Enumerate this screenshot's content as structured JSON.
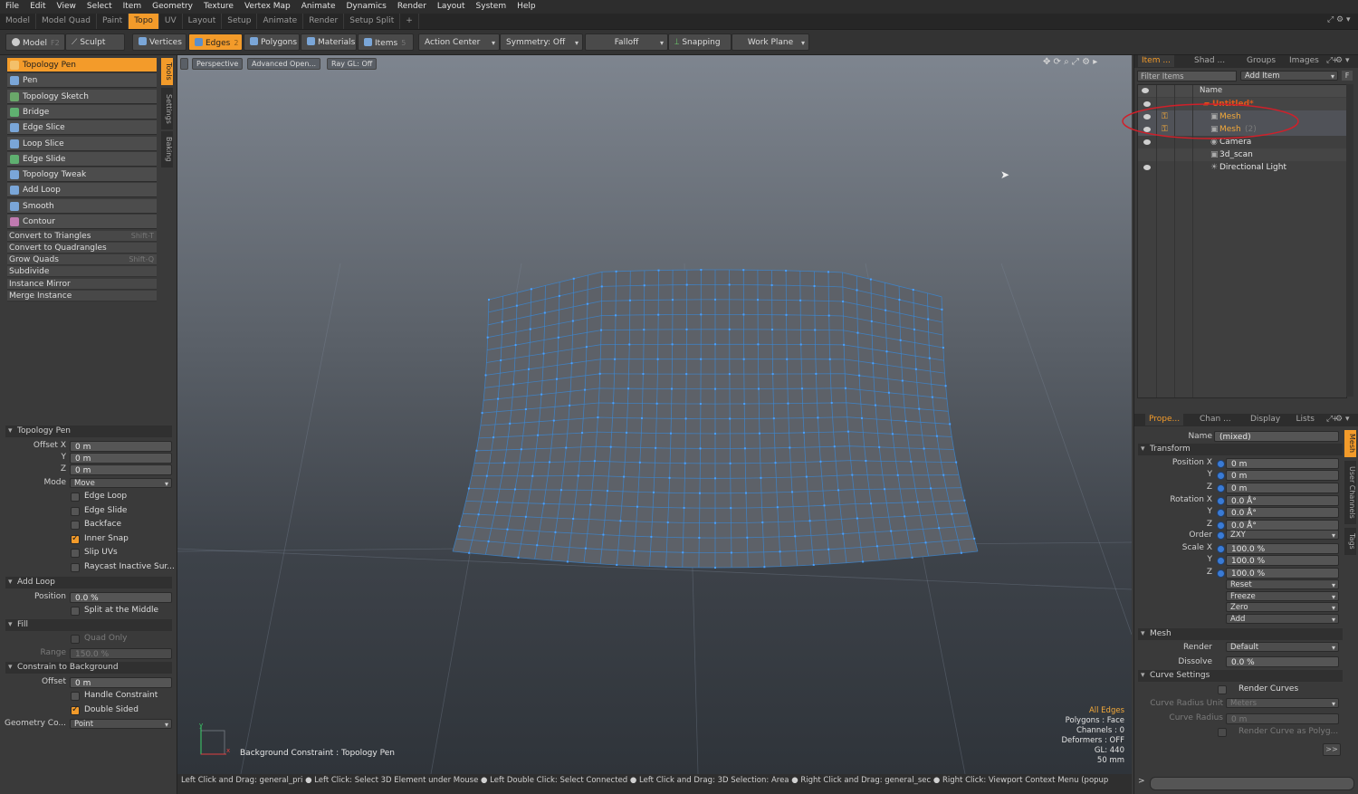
{
  "menu": [
    "File",
    "Edit",
    "View",
    "Select",
    "Item",
    "Geometry",
    "Texture",
    "Vertex Map",
    "Animate",
    "Dynamics",
    "Render",
    "Layout",
    "System",
    "Help"
  ],
  "layouts": [
    "Model",
    "Model Quad",
    "Paint",
    "Topo",
    "UV",
    "Layout",
    "Setup",
    "Animate",
    "Render",
    "Setup Split",
    "+"
  ],
  "layouts_active": "Topo",
  "toolbar": {
    "model": "Model",
    "model_key": "F2",
    "sculpt": "Sculpt",
    "vertices": "Vertices",
    "edges": "Edges",
    "edges_count": "2",
    "polygons": "Polygons",
    "materials": "Materials",
    "items": "Items",
    "items_count": "5",
    "action_center": "Action Center",
    "symmetry": "Symmetry: Off",
    "falloff": "Falloff",
    "snapping": "Snapping",
    "work_plane": "Work Plane"
  },
  "side_tabs": [
    "Tools",
    "Settings",
    "Baking"
  ],
  "tools": [
    "Topology Pen",
    "Pen",
    "Topology Sketch",
    "Bridge",
    "Edge Slice",
    "Loop Slice",
    "Edge Slide",
    "Topology Tweak",
    "Add Loop",
    "Smooth",
    "Contour"
  ],
  "tool_selected": "Topology Pen",
  "commands": [
    {
      "label": "Convert to Triangles",
      "shortcut": "Shift-T"
    },
    {
      "label": "Convert to Quadrangles",
      "shortcut": ""
    },
    {
      "label": "Grow Quads",
      "shortcut": "Shift-Q"
    },
    {
      "label": "Subdivide",
      "shortcut": ""
    }
  ],
  "commands2": [
    "Instance Mirror",
    "Merge Instance"
  ],
  "props": {
    "section_title": "Topology Pen",
    "offset_label": "Offset X",
    "y_label": "Y",
    "z_label": "Z",
    "offset_x": "0 m",
    "offset_y": "0 m",
    "offset_z": "0 m",
    "mode_label": "Mode",
    "mode": "Move",
    "checks": [
      {
        "label": "Edge Loop",
        "on": false
      },
      {
        "label": "Edge Slide",
        "on": false
      },
      {
        "label": "Backface",
        "on": false
      },
      {
        "label": "Inner Snap",
        "on": true
      },
      {
        "label": "Slip UVs",
        "on": false
      },
      {
        "label": "Raycast Inactive Sur...",
        "on": false
      }
    ],
    "add_loop_title": "Add Loop",
    "position_label": "Position",
    "position": "0.0 %",
    "split_middle": "Split at the Middle",
    "fill_title": "Fill",
    "quad_only": "Quad Only",
    "range_label": "Range",
    "range": "150.0 %",
    "constrain_title": "Constrain to Background",
    "offset2_label": "Offset",
    "offset2": "0 m",
    "handle_constraint": "Handle Constraint",
    "double_sided": "Double Sided",
    "geometry_label": "Geometry Co...",
    "geometry_value": "Point"
  },
  "viewport": {
    "perspective": "Perspective",
    "advanced": "Advanced Open...",
    "raygl": "Ray GL: Off",
    "constraint_label": "Background Constraint",
    "tool_label": "Topology Pen",
    "info_title": "All Edges",
    "info_lines": [
      "Polygons : Face",
      "Channels : 0",
      "Deformers : OFF",
      "GL: 440",
      "50 mm"
    ]
  },
  "status": "Left Click and Drag: general_pri ● Left Click: Select 3D Element under Mouse ● Left Double Click: Select Connected ● Left Click and Drag: 3D Selection: Area ● Right Click and Drag: general_sec ● Right Click: Viewport Context Menu (popup",
  "items_panel": {
    "tabs": [
      "Item ...",
      "Shad ...",
      "Groups",
      "Images",
      "+"
    ],
    "filter": "Filter Items",
    "add_item": "Add Item",
    "name_header": "Name",
    "rows": [
      {
        "label": "Untitled*",
        "kind": "scene",
        "selected": false
      },
      {
        "label": "Mesh",
        "kind": "mesh",
        "selected": true
      },
      {
        "label": "Mesh",
        "suffix": "(2)",
        "kind": "mesh",
        "selected": true
      },
      {
        "label": "Camera",
        "kind": "camera",
        "selected": false
      },
      {
        "label": "3d_scan",
        "kind": "scan",
        "selected": false
      },
      {
        "label": "Directional Light",
        "kind": "light",
        "selected": false
      }
    ]
  },
  "properties_panel": {
    "tabs": [
      "Prope...",
      "Chan ...",
      "Display",
      "Lists",
      "+"
    ],
    "side_tabs": [
      "Mesh",
      "User Channels",
      "Tags"
    ],
    "name_label": "Name",
    "name_value": "(mixed)",
    "transform_title": "Transform",
    "position_label": "Position X",
    "rotation_label": "Rotation X",
    "scale_label": "Scale X",
    "y_label": "Y",
    "z_label": "Z",
    "position": [
      "0 m",
      "0 m",
      "0 m"
    ],
    "rotation": [
      "0.0 Å°",
      "0.0 Å°",
      "0.0 Å°"
    ],
    "order_label": "Order",
    "order": "ZXY",
    "scale": [
      "100.0 %",
      "100.0 %",
      "100.0 %"
    ],
    "actions": [
      "Reset",
      "Freeze",
      "Zero",
      "Add"
    ],
    "mesh_title": "Mesh",
    "render_label": "Render",
    "render": "Default",
    "dissolve_label": "Dissolve",
    "dissolve": "0.0 %",
    "curve_title": "Curve Settings",
    "render_curves": "Render Curves",
    "curve_radius_unit_label": "Curve Radius Unit",
    "curve_radius_unit": "Meters",
    "curve_radius_label": "Curve Radius",
    "curve_radius": "0 m",
    "render_curve_poly": "Render Curve as Polyg...",
    "more": ">>"
  },
  "colors": {
    "accent": "#f39b2a",
    "selection": "#e05a1a",
    "annotation": "#d0202a",
    "wire": "#3a8ad8"
  }
}
